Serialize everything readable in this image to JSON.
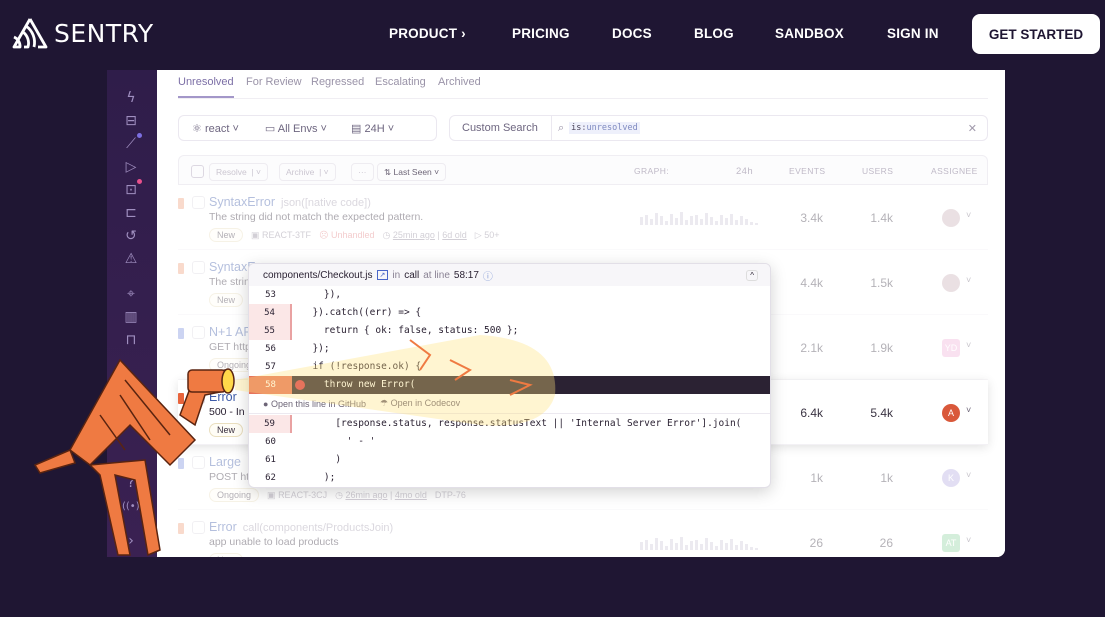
{
  "nav": {
    "brand": "SENTRY",
    "links": [
      "PRODUCT",
      "PRICING",
      "DOCS",
      "BLOG",
      "SANDBOX",
      "SIGN IN"
    ],
    "product_chevron_icon": "chevron-right-icon",
    "cta": "GET STARTED"
  },
  "app": {
    "tabs": [
      "Unresolved",
      "For Review",
      "Regressed",
      "Escalating",
      "Archived"
    ],
    "active_tab": "Unresolved",
    "filters": {
      "project": "react",
      "env": "All Envs",
      "period": "24H",
      "custom_search": "Custom Search",
      "query_key": "is",
      "query_value": "unresolved"
    },
    "toolbar": {
      "resolve": "Resolve",
      "archive": "Archive",
      "more": "···",
      "sort": "Last Seen"
    },
    "columns": {
      "graph": "GRAPH:",
      "period": "24h",
      "events": "EVENTS",
      "users": "USERS",
      "assignee": "ASSIGNEE"
    },
    "issues": [
      {
        "title": "SyntaxError",
        "culprit": "json([native code])",
        "message": "The string did not match the expected pattern.",
        "status": "New",
        "short_id": "REACT-3TF",
        "handled": "Unhandled",
        "last_seen": "25min ago",
        "age": "6d old",
        "replays": "50+",
        "events": "3.4k",
        "users": "1.4k",
        "assignee": "",
        "level_color": "#f0a07c"
      },
      {
        "title": "SyntaxError",
        "culprit": "",
        "message": "The string did not match the expected pattern.",
        "status": "New",
        "events": "4.4k",
        "users": "1.5k",
        "assignee": "",
        "level_color": "#f0a07c"
      },
      {
        "title": "N+1 API Call",
        "culprit": "",
        "message": "GET http",
        "status": "Ongoing",
        "events": "2.1k",
        "users": "1.9k",
        "assignee": "YD",
        "level_color": "#7a8fdf"
      },
      {
        "title": "Error",
        "culprit": "",
        "message": "500 - In",
        "status": "New",
        "events": "6.4k",
        "users": "5.4k",
        "assignee": "A",
        "level_color": "#e8643c"
      },
      {
        "title": "Large",
        "culprit": "",
        "message": "POST ht",
        "status": "Ongoing",
        "short_id": "REACT-3CJ",
        "last_seen": "26min ago",
        "age": "4mo old",
        "ticket": "DTP-76",
        "events": "1k",
        "users": "1k",
        "assignee": "K",
        "level_color": "#7a8fdf"
      },
      {
        "title": "Error",
        "culprit": "call(components/ProductsJoin)",
        "message": "app unable to load products",
        "status": "New",
        "events": "26",
        "users": "26",
        "assignee": "AT",
        "level_color": "#f0a07c"
      }
    ],
    "sidebar_icons": [
      "issues-icon",
      "projects-icon",
      "performance-icon",
      "replays-icon",
      "ai-icon",
      "feedback-icon",
      "releases-icon",
      "alerts-icon",
      "discover-icon",
      "dashboards-icon",
      "archive-icon",
      "stats-icon",
      "help-icon",
      "broadcast-icon",
      "expand-icon"
    ]
  },
  "popup": {
    "file": "components/Checkout.js",
    "in": "in",
    "function": "call",
    "at_line_label": "at line",
    "position": "58:17",
    "lines": [
      {
        "n": "53",
        "code": "    }),"
      },
      {
        "n": "54",
        "code": "  }).catch((err) => {"
      },
      {
        "n": "55",
        "code": "    return { ok: false, status: 500 };"
      },
      {
        "n": "56",
        "code": "  });"
      },
      {
        "n": "57",
        "code": "  if (!response.ok) {"
      },
      {
        "n": "58",
        "code": "    throw new Error("
      }
    ],
    "lines_after": [
      {
        "n": "59",
        "code": "      [response.status, response.statusText || 'Internal Server Error'].join("
      },
      {
        "n": "60",
        "code": "        ' - '"
      },
      {
        "n": "61",
        "code": "      )"
      },
      {
        "n": "62",
        "code": "    );"
      }
    ],
    "open_github": "Open this line in GitHub",
    "open_codecov": "Open in Codecov"
  },
  "colors": {
    "background": "#1f1633",
    "accent": "#e8643c",
    "mascot": "#ef7a42"
  }
}
